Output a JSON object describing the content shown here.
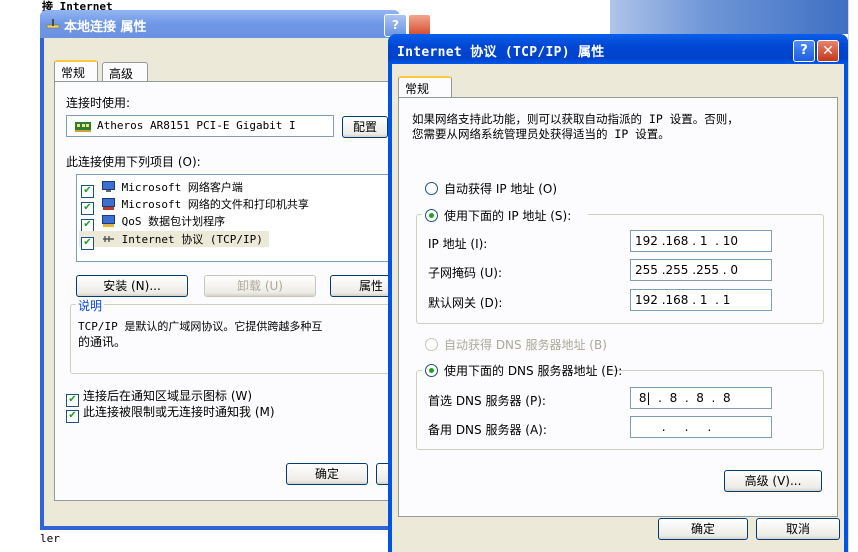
{
  "background": {
    "top_text": "接 Internet",
    "bottom_text": "ler"
  },
  "window1": {
    "title": "本地连接 属性",
    "tabs": [
      "常规",
      "高级"
    ],
    "connect_using_label": "连接时使用:",
    "adapter_name": "Atheros AR8151 PCI-E Gigabit I",
    "configure_button": "配置",
    "items_label": "此连接使用下列项目 (O):",
    "items": [
      "Microsoft 网络客户端",
      "Microsoft 网络的文件和打印机共享",
      "QoS 数据包计划程序",
      "Internet 协议 (TCP/IP)"
    ],
    "install_button": "安装 (N)...",
    "uninstall_button": "卸载 (U)",
    "properties_button": "属性",
    "description_title": "说明",
    "description_text_1": "TCP/IP 是默认的广域网协议。它提供跨越多种互",
    "description_text_2": "的通讯。",
    "show_icon_label": "连接后在通知区域显示图标 (W)",
    "notify_label": "此连接被限制或无连接时通知我 (M)",
    "ok_button": "确定"
  },
  "window2": {
    "title": "Internet 协议 (TCP/IP) 属性",
    "tab": "常规",
    "intro_1": "如果网络支持此功能，则可以获取自动指派的 IP 设置。否则，",
    "intro_2": "您需要从网络系统管理员处获得适当的 IP 设置。",
    "auto_ip_label": "自动获得 IP 地址 (O)",
    "manual_ip_label": "使用下面的 IP 地址 (S):",
    "ip_label": "IP 地址 (I):",
    "ip_value": "192 .168 . 1  . 10",
    "mask_label": "子网掩码 (U):",
    "mask_value": "255 .255 .255 . 0",
    "gateway_label": "默认网关 (D):",
    "gateway_value": "192 .168 . 1  . 1",
    "auto_dns_label": "自动获得 DNS 服务器地址 (B)",
    "manual_dns_label": "使用下面的 DNS 服务器地址 (E):",
    "preferred_dns_label": "首选 DNS 服务器 (P):",
    "preferred_dns_value": " 8|  .  8  .  8  .  8",
    "alternate_dns_label": "备用 DNS 服务器 (A):",
    "alternate_dns_value": "       .     .     .",
    "advanced_button": "高级 (V)...",
    "ok_button": "确定",
    "cancel_button": "取消",
    "help_symbol": "?",
    "close_symbol": "✕"
  }
}
